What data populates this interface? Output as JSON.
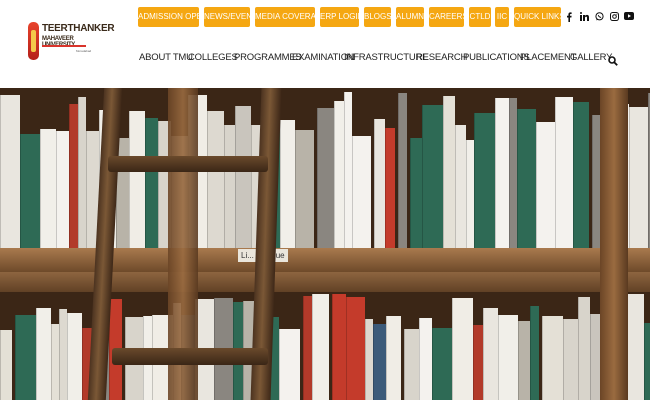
{
  "logo": {
    "line1": "TEERTHANKER",
    "line2": "MAHAVEER UNIVERSITY",
    "line3": "Moradabad"
  },
  "topbar": {
    "buttons": [
      {
        "label": "ADMISSION OPEN"
      },
      {
        "label": "NEWS/EVENT"
      },
      {
        "label": "MEDIA COVERAGE"
      },
      {
        "label": "ERP LOGIN"
      },
      {
        "label": "BLOGS"
      },
      {
        "label": "ALUMNI"
      },
      {
        "label": "CAREERS"
      },
      {
        "label": "CTLD"
      },
      {
        "label": "IIC"
      },
      {
        "label": "QUICK LINKS"
      }
    ],
    "accent": "#f5a712"
  },
  "social": {
    "icons": [
      "facebook-icon",
      "linkedin-icon",
      "whatsapp-icon",
      "instagram-icon",
      "youtube-icon"
    ]
  },
  "nav": {
    "items": [
      {
        "label": "ABOUT TMU"
      },
      {
        "label": "COLLEGES"
      },
      {
        "label": "PROGRAMMES"
      },
      {
        "label": "EXAMINATION"
      },
      {
        "label": "INFRASTRUCTURE"
      },
      {
        "label": "RESEARCH"
      },
      {
        "label": "PUBLICATIONS"
      },
      {
        "label": "PLACEMENT"
      },
      {
        "label": "GALLERY"
      }
    ],
    "search_icon": "search-icon"
  },
  "hero": {
    "shelf_tag": "Li... panique"
  }
}
